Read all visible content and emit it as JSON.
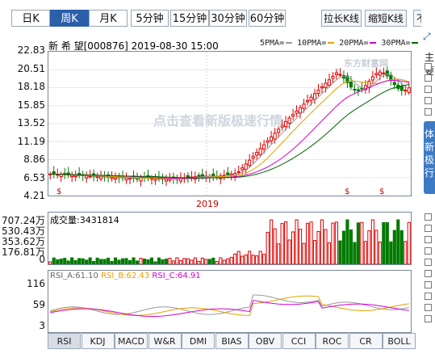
{
  "periods": {
    "tabs": [
      "日K",
      "周K",
      "月K",
      "5分钟",
      "15分钟",
      "30分钟",
      "60分钟"
    ],
    "active_index": 1
  },
  "actions": {
    "stretch": "拉长K线",
    "shorten": "缩短K线",
    "restore": "不复"
  },
  "stock": {
    "header": "新 希 望[000876] 2019-08-30 15:00"
  },
  "ma_legend": [
    {
      "label": "5PMA=",
      "color": "#999999"
    },
    {
      "label": "10PMA=",
      "color": "#e6a000"
    },
    {
      "label": "20PMA=",
      "color": "#d400d4"
    },
    {
      "label": "30PMA=",
      "color": "#006400"
    }
  ],
  "price_axis": [
    "22.83",
    "20.51",
    "18.18",
    "15.85",
    "13.52",
    "11.19",
    "8.86",
    "6.53",
    "4.21"
  ],
  "year_label": "2019",
  "watermark": "点击查看新版极速行情",
  "logo": "东方财富网",
  "volume": {
    "label": "成交量:3431814",
    "axis": [
      "707.24万",
      "530.43万",
      "353.62万",
      "176.81万",
      "0"
    ]
  },
  "rsi": {
    "rsi_a": "RSI_A:61.10",
    "rsi_b": "RSI_B:62.43",
    "rsi_c": "RSI_C:64.91",
    "axis": [
      "116",
      "59",
      "3"
    ],
    "colors": {
      "a": "#999999",
      "b": "#e6a000",
      "c": "#d400d4"
    }
  },
  "indicator_tabs": [
    "RSI",
    "KDJ",
    "MACD",
    "W&R",
    "DMI",
    "BIAS",
    "OBV",
    "CCI",
    "ROC",
    "CR",
    "BOLL"
  ],
  "indicator_active": 0,
  "right_panel": {
    "title": "主要",
    "ad_text": [
      "体",
      "新",
      "极",
      "行"
    ]
  },
  "colors": {
    "up": "#e00000",
    "down": "#007a00",
    "accent": "#2b5fa9"
  }
}
